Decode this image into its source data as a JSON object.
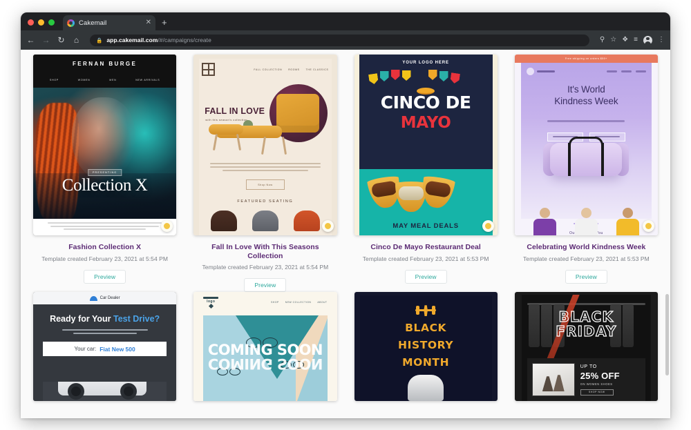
{
  "browser": {
    "tab": {
      "title": "Cakemail",
      "favicon_icon": "cakemail-favicon",
      "close_icon": "close-icon"
    },
    "new_tab_label": "+",
    "back_icon": "back-arrow-icon",
    "forward_icon": "forward-arrow-icon",
    "reload_icon": "reload-icon",
    "home_icon": "home-icon",
    "lock_icon": "lock-icon",
    "url_domain": "app.cakemail.com",
    "url_path": "/#/campaigns/create",
    "toolbar_icons": [
      "key-icon",
      "star-icon",
      "extensions-icon",
      "reading-list-icon",
      "profile-avatar-icon",
      "more-menu-icon"
    ]
  },
  "templates": [
    {
      "title": "Fashion Collection X",
      "subtitle": "Template created February 23, 2021 at 5:54 PM",
      "preview_label": "Preview",
      "art": {
        "brand": "FERNAN BURGE",
        "nav": [
          "SHOP",
          "WOMEN",
          "MEN",
          "NEW ARRIVALS"
        ],
        "eyebrow": "PRESENTING",
        "headline": "Collection X"
      }
    },
    {
      "title": "Fall In Love With This Seasons Collection",
      "subtitle": "Template created February 23, 2021 at 5:54 PM",
      "preview_label": "Preview",
      "art": {
        "nav": [
          "FALL COLLECTION",
          "ROOMS",
          "THE CLASSICS"
        ],
        "headline": "FALL IN LOVE",
        "subhead": "with this season's collection",
        "cta": "Shop Now",
        "section": "FEATURED SEATING"
      }
    },
    {
      "title": "Cinco De Mayo Restaurant Deal",
      "subtitle": "Template created February 23, 2021 at 5:53 PM",
      "preview_label": "Preview",
      "art": {
        "logo_text": "YOUR LOGO HERE",
        "headline1": "CINCO DE",
        "headline2": "MAYO",
        "footer": "MAY MEAL DEALS"
      }
    },
    {
      "title": "Celebrating World Kindness Week",
      "subtitle": "Template created February 23, 2021 at 5:53 PM",
      "preview_label": "Preview",
      "art": {
        "banner": "Free shipping on orders $50+",
        "headline": "It's World\nKindness Week",
        "headline_l1": "It's World",
        "headline_l2": "Kindness Week",
        "buttons": [
          "Explore Accessories",
          "Explore Clothes"
        ],
        "picks": "Our Picks For You"
      }
    },
    {
      "title": "",
      "subtitle": "",
      "preview_label": "",
      "art": {
        "brand": "Car Dealer",
        "headline_a": "Ready for Your ",
        "headline_b": "Test Drive?",
        "car_label": "Your car:",
        "car_value": "Fiat New 500"
      }
    },
    {
      "title": "",
      "subtitle": "",
      "preview_label": "",
      "art": {
        "logo": "logo",
        "nav": [
          "SHOP",
          "NEW COLLECTION",
          "ABOUT"
        ],
        "headline": "COMING SOON"
      }
    },
    {
      "title": "",
      "subtitle": "",
      "preview_label": "",
      "art": {
        "line1": "BLACK",
        "line2": "HISTORY",
        "line3": "MONTH"
      }
    },
    {
      "title": "",
      "subtitle": "",
      "preview_label": "",
      "art": {
        "line1": "BLACK",
        "line2": "FRIDAY",
        "upto": "UP TO",
        "percent": "25% OFF",
        "on": "ON WOMEN SHOES",
        "cta": "SHOP NOW"
      }
    }
  ],
  "colors": {
    "title_purple": "#5c2b74",
    "subtitle_gray": "#7b7f86",
    "preview_teal": "#2aa79b",
    "badge_gold": "#f3c645",
    "page_bg": "#fafafa"
  }
}
